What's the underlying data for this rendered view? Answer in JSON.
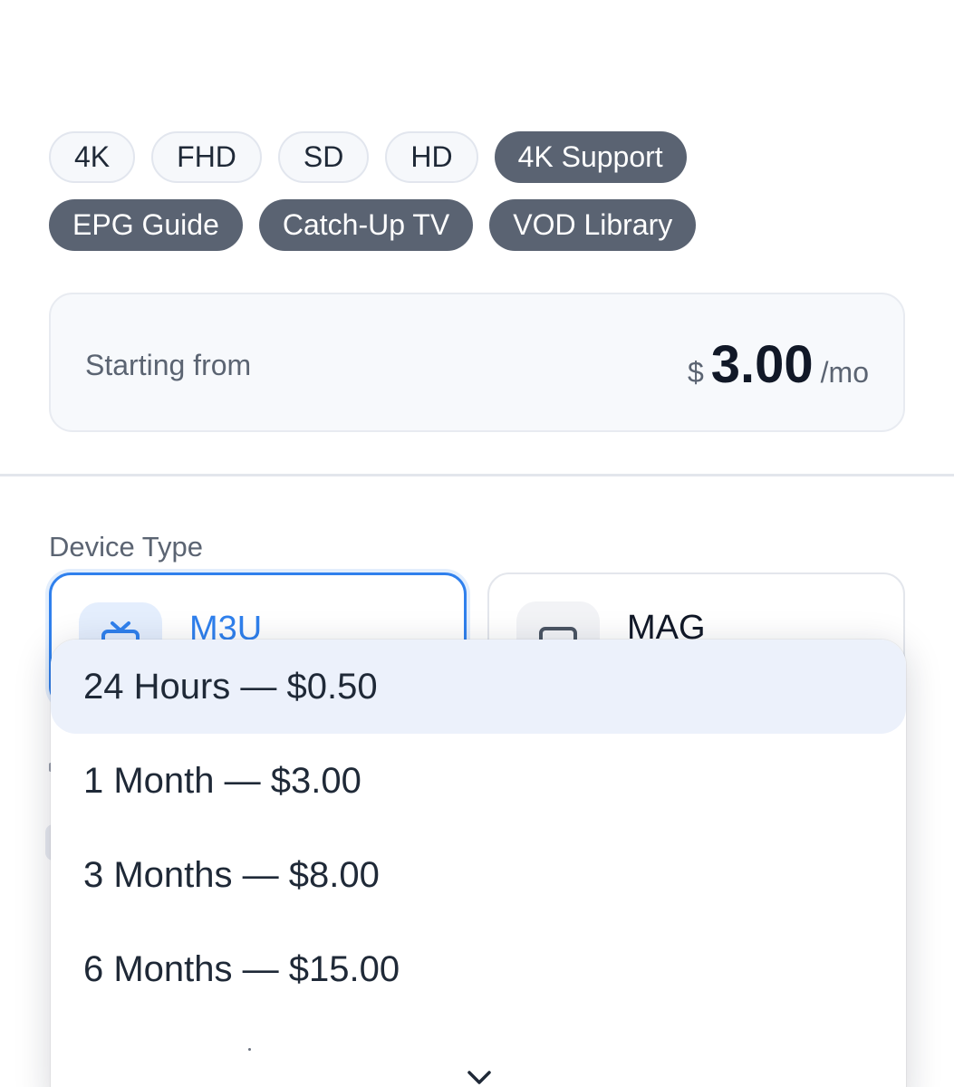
{
  "tags": {
    "row1": [
      {
        "label": "4K",
        "style": "outline"
      },
      {
        "label": "FHD",
        "style": "outline"
      },
      {
        "label": "SD",
        "style": "outline"
      },
      {
        "label": "HD",
        "style": "outline"
      },
      {
        "label": "4K Support",
        "style": "filled"
      }
    ],
    "row2": [
      {
        "label": "EPG Guide",
        "style": "filled"
      },
      {
        "label": "Catch-Up TV",
        "style": "filled"
      },
      {
        "label": "VOD Library",
        "style": "filled"
      }
    ]
  },
  "price": {
    "label": "Starting from",
    "currency": "$",
    "amount": "3.00",
    "unit": "/mo"
  },
  "device_type": {
    "label": "Device Type",
    "options": [
      {
        "name": "M3U",
        "icon": "tv-icon",
        "selected": true
      },
      {
        "name": "MAG",
        "icon": "set-top-box-icon",
        "selected": false
      }
    ]
  },
  "duration_dropdown": {
    "options": [
      {
        "label": "24 Hours — $0.50",
        "highlighted": true
      },
      {
        "label": "1 Month — $3.00",
        "highlighted": false
      },
      {
        "label": "3 Months — $8.00",
        "highlighted": false
      },
      {
        "label": "6 Months — $15.00",
        "highlighted": false
      }
    ],
    "more_indicator_icon": "chevron-down-icon"
  },
  "colors": {
    "accent": "#2f80ed",
    "tag_filled": "#5a6372",
    "highlight": "#ecf1fb"
  }
}
